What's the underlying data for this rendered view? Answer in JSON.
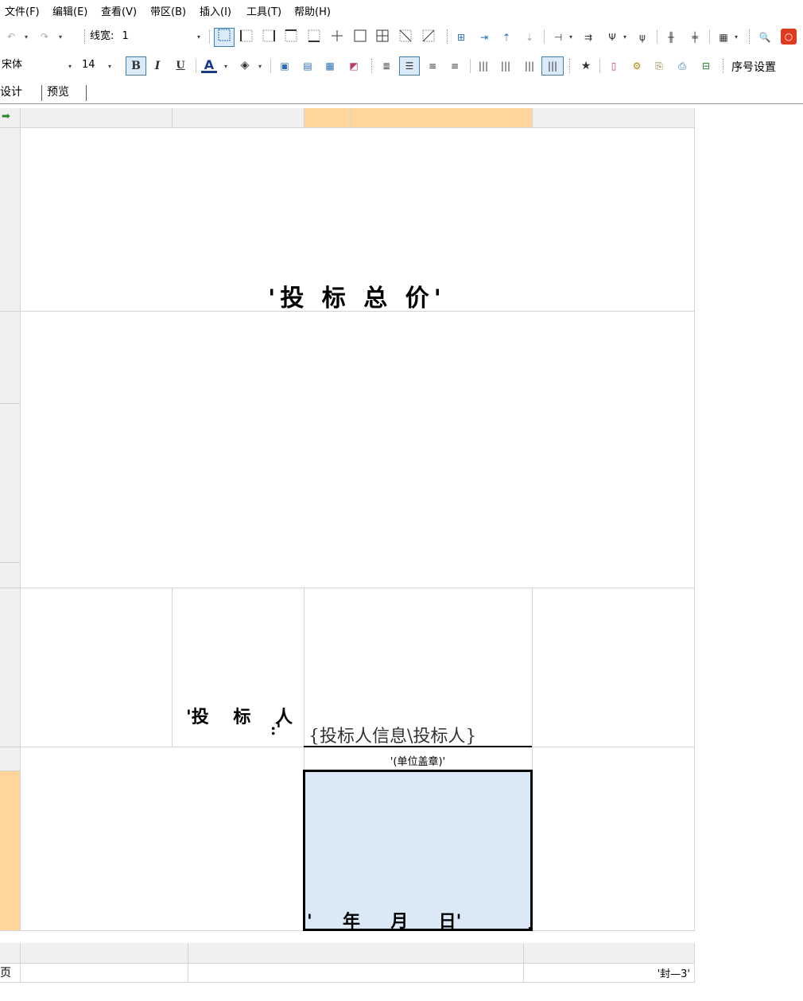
{
  "menu": {
    "items": [
      "文件(F)",
      "编辑(E)",
      "查看(V)",
      "带区(B)",
      "插入(I)",
      "工具(T)",
      "帮助(H)"
    ]
  },
  "toolbar1": {
    "line_width_label": "线宽:",
    "line_width_value": "1"
  },
  "toolbar2": {
    "font_name": "宋体",
    "font_size": "14",
    "bold_label": "B",
    "italic_label": "I",
    "underline_label": "U",
    "font_color_label": "A",
    "star_label": "★",
    "sequence_settings_label": "序号设置"
  },
  "tabs": {
    "design": "设计",
    "preview": "预览"
  },
  "report": {
    "title": "'投 标 总 价'",
    "bidder_label_main": "'投    标    人",
    "bidder_label_colon": ":'",
    "bidder_field": "{投标人信息\\投标人}",
    "seal_note": "'(单位盖章)'",
    "date_line": "'     年     月     日'",
    "page_label": "页",
    "page_code": "'封—3'"
  },
  "colors": {
    "selection_fill": "#dbe9f7",
    "band_marker": "#ffd699",
    "grid_line": "#d4d4d4",
    "close_button": "#e03a1e"
  }
}
